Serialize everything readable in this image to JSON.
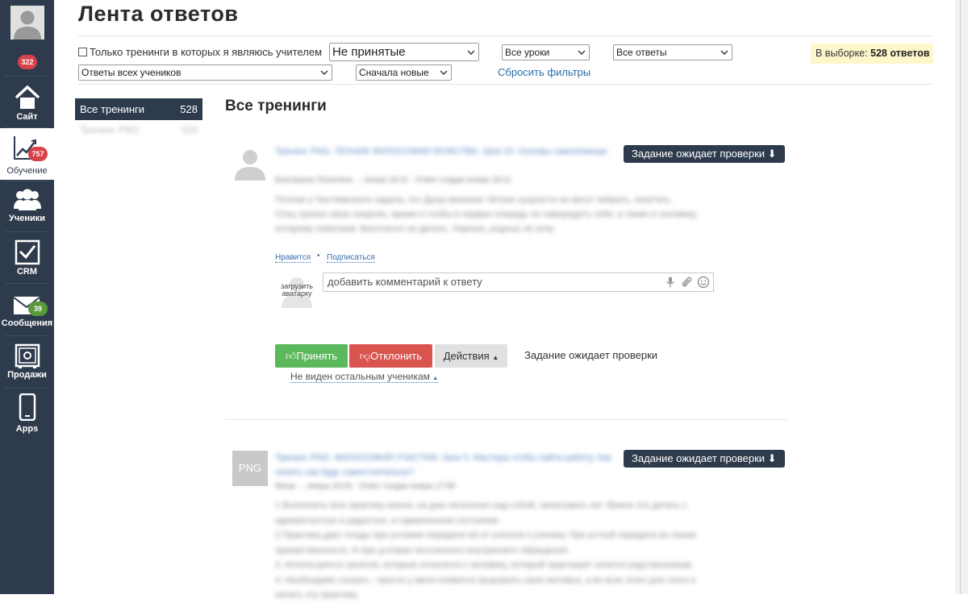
{
  "header": {
    "title": "Лента ответов"
  },
  "sidebar": {
    "notifications_badge": "322",
    "items": [
      {
        "label": "Сайт",
        "badge": ""
      },
      {
        "label": "Обучение",
        "badge": "757"
      },
      {
        "label": "Ученики",
        "badge": ""
      },
      {
        "label": "CRM",
        "badge": ""
      },
      {
        "label": "Сообщения",
        "badge": "39"
      },
      {
        "label": "Продажи",
        "badge": ""
      },
      {
        "label": "Apps",
        "badge": ""
      }
    ]
  },
  "filters": {
    "only_my_trainings_label": "Только тренинги в которых я являюсь учителем",
    "status_select": "Не принятые",
    "lessons_select": "Все уроки",
    "answers_select": "Все ответы",
    "students_select": "Ответы всех учеников",
    "sort_select": "Сначала новые",
    "reset_label": "Сбросить фильтры",
    "selection_prefix": "В выборке:",
    "selection_count": "528 ответов"
  },
  "trainings": {
    "active": {
      "label": "Все тренинги",
      "count": "528"
    },
    "second": {
      "label": "Тренинг PNG",
      "count": "528"
    }
  },
  "main": {
    "section_title": "Все тренинги"
  },
  "answers": [
    {
      "status_button": "Задание ожидает проверки ⬇",
      "blurred_title": "Тренинг PNG. ТЕХНИК ФИЛОСОФИИ МУЖСТВА. Урок 20. Основы самопомощи",
      "blurred_author": "Екатерина Лопатина → вчера 18:11 · Ответ создан вчера 18:11",
      "blurred_text_1": "Плохая у Чистяменкого задача, это Душу вижание Чёткая сущности не могут забрать, запутать.",
      "blurred_text_2": "Отец трапни свою энергию, время и чтобы в первую очередь не наворадить себе, а также и человеку,",
      "blurred_text_3": "которому помогаем. Бесплатно не делать. Хорошо, родных не хочу.",
      "like_label": "Нравится",
      "subscribe_label": "Подписаться",
      "upload_avatar_label": "загрузить аватарку",
      "comment_placeholder": "добавить комментарий к ответу",
      "accept_label": "Принять",
      "reject_label": "Отклонить",
      "actions_label": "Действия",
      "status_text": "Задание ожидает проверки",
      "visibility_label": "Не виден остальным ученикам"
    },
    {
      "status_button": "Задание ожидает проверки ⬇",
      "thumb_label": "PNG",
      "blurred_title": "Тренинг PNG. ФИЛОСОФИЯ УЧАСТИЯ. Урок 5. Мастера чтобы найти работу. Как понять как будь самостоятельно?",
      "blurred_author": "Жиза → вчера 18:03 · Ответ создан вчера 17:58",
      "blurred_text_1": "1 Выполнить всю практику жизни, на дню несколько над собой, записывать нет. Важно это делать с",
      "blurred_text_2": "адекватностью и радостью, в гармоничном состоянии.",
      "blurred_text_3": "2 Практика дает плоды при условии передачи её от учителя к ученику. При устной передаче во линии",
      "blurred_text_4": "преемственности. И при условии постоянного внутреннего обращения.",
      "blurred_text_5": "3. Используются занятия, которые относятся к человеку, который практикует хочется родственникам.",
      "blurred_text_6": "4. Необходимо сказать - просто у меня появится (выражать свою мотивы), а во всех этого для этого и",
      "blurred_text_7": "начать эту практику."
    }
  ],
  "icons": {
    "user": "user-silhouette-icon",
    "home": "home-icon",
    "learning": "chart-icon",
    "students": "group-icon",
    "crm": "checkbox-icon",
    "messages": "envelope-icon",
    "sales": "safe-icon",
    "apps": "phone-icon"
  },
  "colors": {
    "sidebar_bg": "#2e3b4d",
    "accept": "#5cb85c",
    "reject": "#d9534f",
    "badge_red": "#d9414a",
    "badge_green": "#5a9a3a",
    "link": "#2b6ea8",
    "selection_bg": "#fff7cc"
  }
}
